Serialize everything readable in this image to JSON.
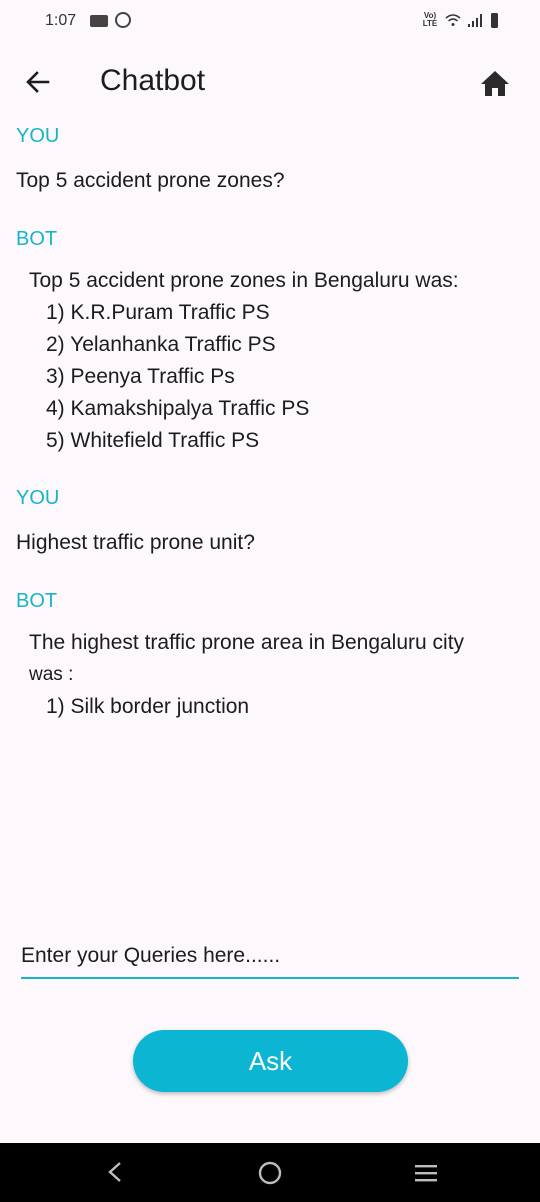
{
  "status_bar": {
    "time": "1:07",
    "network_label": "Vo))\nLTE"
  },
  "app_bar": {
    "title": "Chatbot"
  },
  "messages": [
    {
      "sender": "YOU",
      "text": "Top 5 accident prone zones?"
    },
    {
      "sender": "BOT",
      "lines": [
        "Top 5 accident prone zones in Bengaluru was:",
        "1) K.R.Puram Traffic PS",
        "2) Yelanhanka Traffic PS",
        "3) Peenya Traffic Ps",
        "4) Kamakshipalya Traffic PS",
        "5) Whitefield Traffic PS"
      ]
    },
    {
      "sender": "YOU",
      "text": "Highest traffic prone unit?"
    },
    {
      "sender": "BOT",
      "lines": [
        "The highest traffic prone area in Bengaluru city",
        "was :",
        "1) Silk border junction"
      ]
    }
  ],
  "input": {
    "placeholder": "Enter your Queries here......",
    "value": ""
  },
  "ask_button": {
    "label": "Ask"
  },
  "colors": {
    "accent": "#16b6c8",
    "button": "#0cb6d2",
    "background": "#fdf8fb"
  },
  "icons": {
    "back": "arrow-left-icon",
    "home": "home-icon",
    "nav_back": "chevron-left-icon",
    "nav_home": "circle-icon",
    "nav_menu": "menu-icon"
  }
}
